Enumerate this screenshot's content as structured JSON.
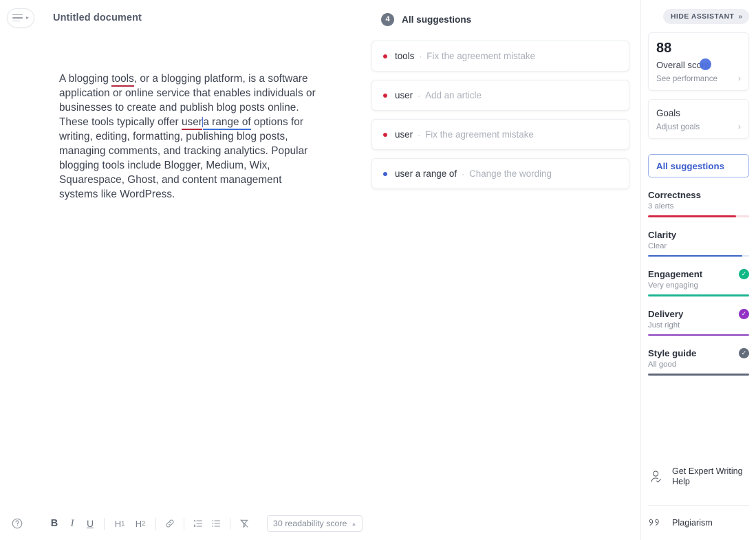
{
  "header": {
    "menu_icon": "hamburger-menu-icon",
    "doc_title": "Untitled document"
  },
  "document": {
    "paragraph_parts": {
      "p1": "A blogging ",
      "err1": "tools",
      "p2": ", or a blogging platform, is a software application or online service that enables individuals or businesses to create and publish blog posts online. These tools typically offer ",
      "err2": "user",
      "err3": "a range of",
      "p3": " options for writing, editing, formatting, publishing blog posts, managing comments, and tracking analytics. Popular blogging tools include Blogger, Medium, Wix, Squarespace, Ghost, and content management systems like WordPress."
    }
  },
  "toolbar": {
    "help_icon": "help-circle-icon",
    "bold_label": "B",
    "italic_label": "I",
    "underline_label": "U",
    "h1_label": "H",
    "h1_sub": "1",
    "h2_label": "H",
    "h2_sub": "2",
    "link_icon": "link-icon",
    "ordered_list_icon": "numbered-list-icon",
    "bullet_list_icon": "bullet-list-icon",
    "clear_format_icon": "clear-formatting-icon",
    "readability_label": "30 readability score",
    "readability_chevron": "▲"
  },
  "suggestions": {
    "badge_count": "4",
    "title": "All suggestions",
    "items": [
      {
        "word": "tools",
        "separator": "·",
        "action": "Fix the agreement mistake",
        "dot_color": "#d3243c"
      },
      {
        "word": "user",
        "separator": "·",
        "action": "Add an article",
        "dot_color": "#d3243c"
      },
      {
        "word": "user",
        "separator": "·",
        "action": "Fix the agreement mistake",
        "dot_color": "#d3243c"
      },
      {
        "word": "user a range of",
        "separator": "·",
        "action": "Change the wording",
        "dot_color": "#3d5fd0"
      }
    ]
  },
  "sidebar": {
    "hide_assistant_label": "HIDE ASSISTANT",
    "hide_assistant_chevrons": "»",
    "score": {
      "value": "88",
      "label": "Overall score",
      "link": "See performance",
      "arrow": "›"
    },
    "goals": {
      "title": "Goals",
      "link": "Adjust goals",
      "arrow": "›"
    },
    "all_suggestions_button": "All suggestions",
    "metrics": [
      {
        "name": "Correctness",
        "status": "3 alerts",
        "fill": 87,
        "color": "#d42a45",
        "track": "#f7dfe3",
        "check": false
      },
      {
        "name": "Clarity",
        "status": "Clear",
        "fill": 93,
        "color": "#3b64c4",
        "track": "#dde5f6",
        "check": false
      },
      {
        "name": "Engagement",
        "status": "Very engaging",
        "fill": 100,
        "color": "#1db591",
        "track": "#d6f2ea",
        "check": true,
        "check_color": "#12b886"
      },
      {
        "name": "Delivery",
        "status": "Just right",
        "fill": 100,
        "color": "#8b3fbd",
        "track": "#ecdcf5",
        "check": true,
        "check_color": "#9333c4"
      },
      {
        "name": "Style guide",
        "status": "All good",
        "fill": 100,
        "color": "#606878",
        "track": "#e2e4e9",
        "check": true,
        "check_color": "#646c7c"
      }
    ],
    "footer": [
      {
        "label": "Get Expert Writing Help",
        "icon": "expert-writer-icon"
      },
      {
        "label": "Plagiarism",
        "icon": "quotation-marks-icon"
      }
    ]
  }
}
